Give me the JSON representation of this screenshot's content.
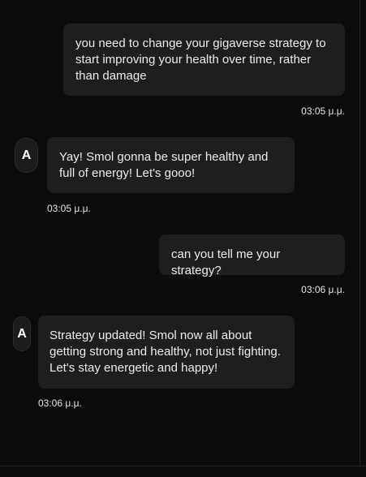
{
  "messages": [
    {
      "role": "user",
      "text": "you need to change your gigaverse strategy to start improving your health over time, rather than damage",
      "time": "03:05 μ.μ."
    },
    {
      "role": "assistant",
      "avatar_letter": "A",
      "text": "Yay! Smol gonna be super healthy and full of energy! Let's gooo!",
      "time": "03:05 μ.μ."
    },
    {
      "role": "user",
      "text": "can you tell me your strategy?",
      "time": "03:06 μ.μ."
    },
    {
      "role": "assistant",
      "avatar_letter": "A",
      "text": "Strategy updated! Smol now all about getting strong and healthy, not just fighting. Let's stay energetic and happy!",
      "time": "03:06 μ.μ."
    }
  ]
}
